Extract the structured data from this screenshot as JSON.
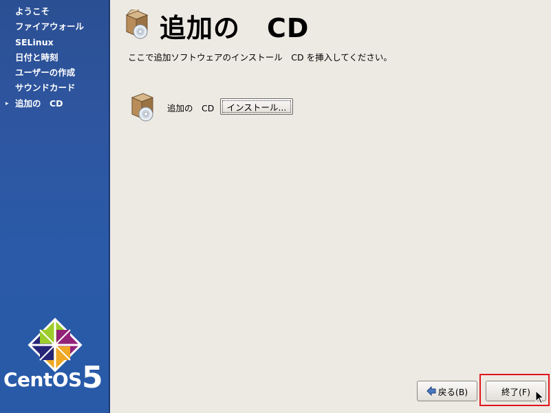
{
  "sidebar": {
    "steps": [
      {
        "label": "ようこそ",
        "current": false
      },
      {
        "label": "ファイアウォール",
        "current": false
      },
      {
        "label": "SELinux",
        "current": false
      },
      {
        "label": "日付と時刻",
        "current": false
      },
      {
        "label": "ユーザーの作成",
        "current": false
      },
      {
        "label": "サウンドカード",
        "current": false
      },
      {
        "label": "追加の　CD",
        "current": true
      }
    ],
    "current_marker": "▸",
    "brand": {
      "name": "CentOS",
      "version": "5"
    }
  },
  "main": {
    "title": "追加の　CD",
    "instruction": "ここで追加ソフトウェアのインストール　CD を挿入してください。",
    "cd_label": "追加の　CD",
    "install_button": "インストール..."
  },
  "nav": {
    "back_label": "戻る(B)",
    "finish_label": "終了(F)"
  },
  "icons": {
    "header": "package-cd-icon",
    "cd_row": "package-cd-icon",
    "back": "back-arrow-icon",
    "cursor": "mouse-pointer-icon"
  },
  "colors": {
    "sidebar_bg": "#2b5aa8",
    "content_bg": "#ede9e3",
    "highlight": "#e0141a"
  }
}
